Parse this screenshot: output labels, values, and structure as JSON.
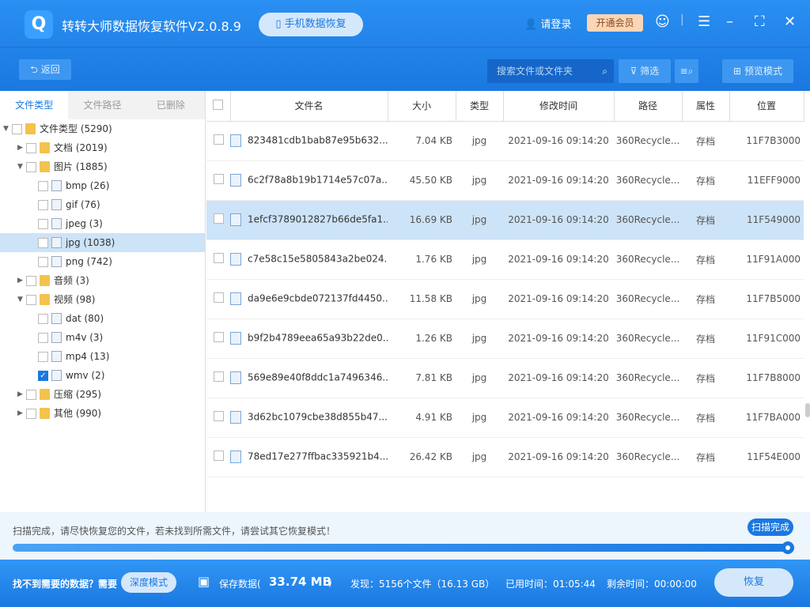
{
  "app": {
    "logo": "Q",
    "title": "转转大师数据恢复软件V2.0.8.9",
    "phone_recovery": "手机数据恢复",
    "login": "请登录",
    "vip": "开通会员"
  },
  "toolbar": {
    "back": "返回",
    "search_placeholder": "搜索文件或文件夹",
    "filter": "筛选",
    "preview_mode": "预览模式"
  },
  "left_tabs": [
    "文件类型",
    "文件路径",
    "已删除"
  ],
  "tree": [
    {
      "label": "文件类型 (5290)",
      "level": 0,
      "arrow": "▼",
      "icon": "folder",
      "checked": false
    },
    {
      "label": "文档 (2019)",
      "level": 1,
      "arrow": "▶",
      "icon": "folder",
      "checked": false
    },
    {
      "label": "图片 (1885)",
      "level": 1,
      "arrow": "▼",
      "icon": "folder",
      "checked": false
    },
    {
      "label": "bmp (26)",
      "level": 2,
      "arrow": "",
      "icon": "file",
      "checked": false
    },
    {
      "label": "gif (76)",
      "level": 2,
      "arrow": "",
      "icon": "file",
      "checked": false
    },
    {
      "label": "jpeg (3)",
      "level": 2,
      "arrow": "",
      "icon": "file",
      "checked": false
    },
    {
      "label": "jpg (1038)",
      "level": 2,
      "arrow": "",
      "icon": "file",
      "checked": false,
      "selected": true
    },
    {
      "label": "png (742)",
      "level": 2,
      "arrow": "",
      "icon": "file",
      "checked": false
    },
    {
      "label": "音频 (3)",
      "level": 1,
      "arrow": "▶",
      "icon": "folder",
      "checked": false
    },
    {
      "label": "视频 (98)",
      "level": 1,
      "arrow": "▼",
      "icon": "folder",
      "checked": false
    },
    {
      "label": "dat (80)",
      "level": 2,
      "arrow": "",
      "icon": "file",
      "checked": false
    },
    {
      "label": "m4v (3)",
      "level": 2,
      "arrow": "",
      "icon": "file",
      "checked": false
    },
    {
      "label": "mp4 (13)",
      "level": 2,
      "arrow": "",
      "icon": "file",
      "checked": false
    },
    {
      "label": "wmv (2)",
      "level": 2,
      "arrow": "",
      "icon": "file",
      "checked": true
    },
    {
      "label": "压缩 (295)",
      "level": 1,
      "arrow": "▶",
      "icon": "folder",
      "checked": false
    },
    {
      "label": "其他 (990)",
      "level": 1,
      "arrow": "▶",
      "icon": "folder",
      "checked": false
    }
  ],
  "table": {
    "headers": [
      "文件名",
      "大小",
      "类型",
      "修改时间",
      "路径",
      "属性",
      "位置"
    ],
    "rows": [
      [
        "823481cdb1bab87e95b632...",
        "7.04 KB",
        "jpg",
        "2021-09-16 09:14:20",
        "360Recycle...",
        "存档",
        "11F7B3000"
      ],
      [
        "6c2f78a8b19b1714e57c07a...",
        "45.50 KB",
        "jpg",
        "2021-09-16 09:14:20",
        "360Recycle...",
        "存档",
        "11EFF9000"
      ],
      [
        "1efcf3789012827b66de5fa1...",
        "16.69 KB",
        "jpg",
        "2021-09-16 09:14:20",
        "360Recycle...",
        "存档",
        "11F549000"
      ],
      [
        "c7e58c15e5805843a2be024...",
        "1.76 KB",
        "jpg",
        "2021-09-16 09:14:20",
        "360Recycle...",
        "存档",
        "11F91A000"
      ],
      [
        "da9e6e9cbde072137fd4450...",
        "11.58 KB",
        "jpg",
        "2021-09-16 09:14:20",
        "360Recycle...",
        "存档",
        "11F7B5000"
      ],
      [
        "b9f2b4789eea65a93b22de0...",
        "1.26 KB",
        "jpg",
        "2021-09-16 09:14:20",
        "360Recycle...",
        "存档",
        "11F91C000"
      ],
      [
        "569e89e40f8ddc1a7496346...",
        "7.81 KB",
        "jpg",
        "2021-09-16 09:14:20",
        "360Recycle...",
        "存档",
        "11F7B8000"
      ],
      [
        "3d62bc1079cbe38d855b47...",
        "4.91 KB",
        "jpg",
        "2021-09-16 09:14:20",
        "360Recycle...",
        "存档",
        "11F7BA000"
      ],
      [
        "78ed17e277ffbac335921b4...",
        "26.42 KB",
        "jpg",
        "2021-09-16 09:14:20",
        "360Recycle...",
        "存档",
        "11F54E000"
      ]
    ],
    "selected_row": 2
  },
  "status": {
    "message": "扫描完成，请尽快恢复您的文件，若未找到所需文件，请尝试其它恢复模式！",
    "bubble": "扫描完成",
    "progress": 1.0
  },
  "bottom": {
    "need": "找不到需要的数据？需要",
    "deep": "深度模式",
    "save_label": "保存数据(",
    "save_value": "33.74 MB",
    "save_close": ")",
    "found": "发现：5156个文件（16.13 GB）",
    "elapsed": "已用时间：01:05:44",
    "remaining": "剩余时间：00:00:00",
    "recover": "恢复"
  }
}
